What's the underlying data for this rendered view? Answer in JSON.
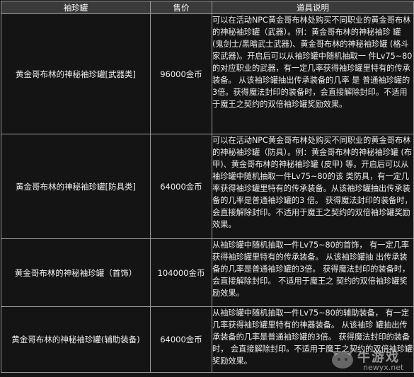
{
  "table": {
    "headers": {
      "name": "袖珍罐",
      "price": "售价",
      "desc": "道具说明"
    },
    "rows": [
      {
        "name": "黄金哥布林的神秘袖珍罐[武器类]",
        "price": "96000金币",
        "desc": "可以在活动NPC黄金哥布林处购买不同职业的黄金哥布林的神秘袖珍罐（武器）。例：黄金哥布林的神秘袖珍 罐 (鬼剑士/黑暗武士武器)、黄金哥布林的神秘袖珍罐 (格斗家武器)。开启后可以从袖珍罐中随机抽取一 件Lv75~80的对应职业的武器，有一定几率获得袖珍罐里特有的传承装备。 从该袖珍罐抽出传承装备的几率 是 普通袖珍罐的3倍。获得魔法封印的装备时，会直接解除封印。不适用于魔王之契约的双倍袖珍罐奖励效果。"
      },
      {
        "name": "黄金哥布林的神秘袖珍罐[防具类]",
        "price": "64000金币",
        "desc": "可以在活动NPC黄金哥布林处购买不同职业的黄金哥布林的神秘袖珍罐（防具）。例：黄金哥布林的神秘袖珍罐 (布甲)、黄金哥布林的神秘袖珍罐 (皮甲) 等。开启后可以从袖珍罐中随机抽取一件Lv75~80的该 类防具，有一定几率获得袖珍罐里特有的传承装备。从该袖珍罐抽出传承装备的几率是普通袖珍罐的3 倍。 获得魔法封印的装备时， 会直接解除封印。不适用于魔王之契约的双倍袖珍罐奖励效果。"
      },
      {
        "name": "黄金哥布林的神秘袖珍罐（首饰）",
        "price": "104000金币",
        "desc": "从袖珍罐中随机抽取一件Lv75~80的首饰， 有一定几率获得袖珍罐里特有的传承装备。 从该袖珍罐抽 出传承装备的几率是普通袖珍罐的3倍。 获得魔法封印的装备时， 会直接解除封印。 不适用于魔王之 契约的双倍袖珍罐奖励效果。"
      },
      {
        "name": "黄金哥布林的神秘袖珍罐(辅助装备)",
        "price": "64000金币",
        "desc": "从袖珍罐中随机抽取一件Lv75~80的辅助装备， 有一定几率获得袖珍罐里特有的神器装备。 从该袖珍 罐抽出传承装备的几率是普通袖珍罐的3倍。 获得魔法封印的装备时， 会直接解除封印。不适用于魔王之契约的双倍袖珍罐奖励效果。"
      }
    ]
  },
  "watermark": {
    "brand": "牛游戏",
    "url": "newyx.net"
  },
  "colors": {
    "background": "#141414",
    "header_bg": "#3a3a3a",
    "border": "#9a9a9a",
    "text": "#e9e9e9"
  }
}
